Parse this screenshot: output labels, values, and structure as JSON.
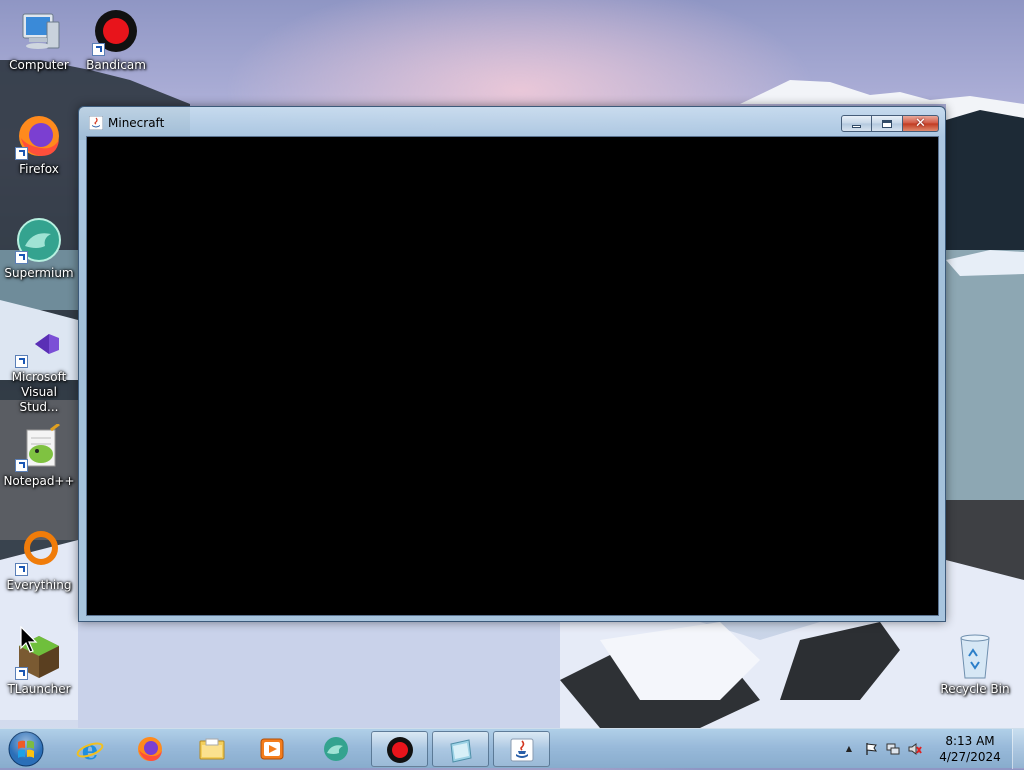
{
  "desktop": {
    "icons": [
      {
        "label": "Computer",
        "icon": "computer-icon"
      },
      {
        "label": "Bandicam",
        "icon": "bandicam-icon"
      },
      {
        "label": "Firefox",
        "icon": "firefox-icon"
      },
      {
        "label": "Supermium",
        "icon": "supermium-icon"
      },
      {
        "label": "Microsoft Visual Stud...",
        "icon": "visual-studio-icon"
      },
      {
        "label": "Notepad++",
        "icon": "notepadpp-icon"
      },
      {
        "label": "Everything",
        "icon": "everything-icon"
      },
      {
        "label": "TLauncher",
        "icon": "tlauncher-icon"
      },
      {
        "label": "Recycle Bin",
        "icon": "recycle-bin-icon"
      }
    ]
  },
  "window": {
    "title": "Minecraft",
    "close_glyph": "✕"
  },
  "taskbar": {
    "pinned": [
      "internet-explorer-icon",
      "firefox-icon",
      "file-explorer-icon",
      "media-player-icon",
      "supermium-icon",
      "bandicam-icon",
      "app-icon",
      "java-icon"
    ],
    "clock": {
      "time": "8:13 AM",
      "date": "4/27/2024"
    },
    "tray_arrow": "▲"
  },
  "colors": {
    "client_background": "#000000",
    "close_button": "#c0391f",
    "bandicam_red": "#e8141b"
  }
}
